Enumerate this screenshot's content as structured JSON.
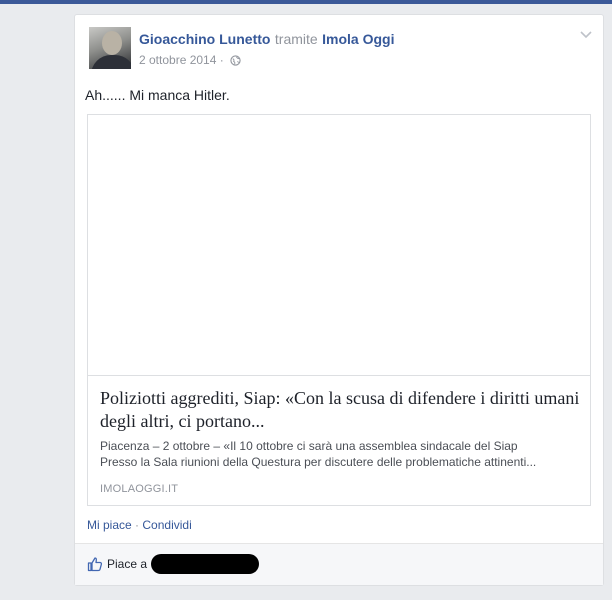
{
  "colors": {
    "link_blue": "#365899",
    "meta_gray": "#90949c",
    "text_dark": "#1d2129",
    "page_bg": "#e9ebee",
    "redaction": "#000000"
  },
  "post": {
    "author": "Gioacchino Lunetto",
    "via": "tramite",
    "source": "Imola Oggi",
    "date": "2 ottobre 2014",
    "date_separator": "·",
    "privacy_icon": "globe-icon",
    "menu_icon": "chevron-down-icon",
    "avatar": "profile-photo",
    "text": "Ah...... Mi manca Hitler."
  },
  "link_preview": {
    "title": "Poliziotti aggrediti, Siap: «Con la scusa di difendere i diritti umani degli altri, ci portano...",
    "description_line1": "Piacenza – 2 ottobre – «Il 10 ottobre ci sarà una assemblea sindacale del Siap",
    "description_line2": "Presso la Sala riunioni della Questura per discutere delle problematiche attinenti...",
    "domain": "IMOLAOGGI.IT"
  },
  "actions": {
    "like": "Mi piace",
    "separator": "·",
    "share": "Condividi"
  },
  "likes": {
    "icon": "thumbs-up-icon",
    "text": "Piace a"
  }
}
